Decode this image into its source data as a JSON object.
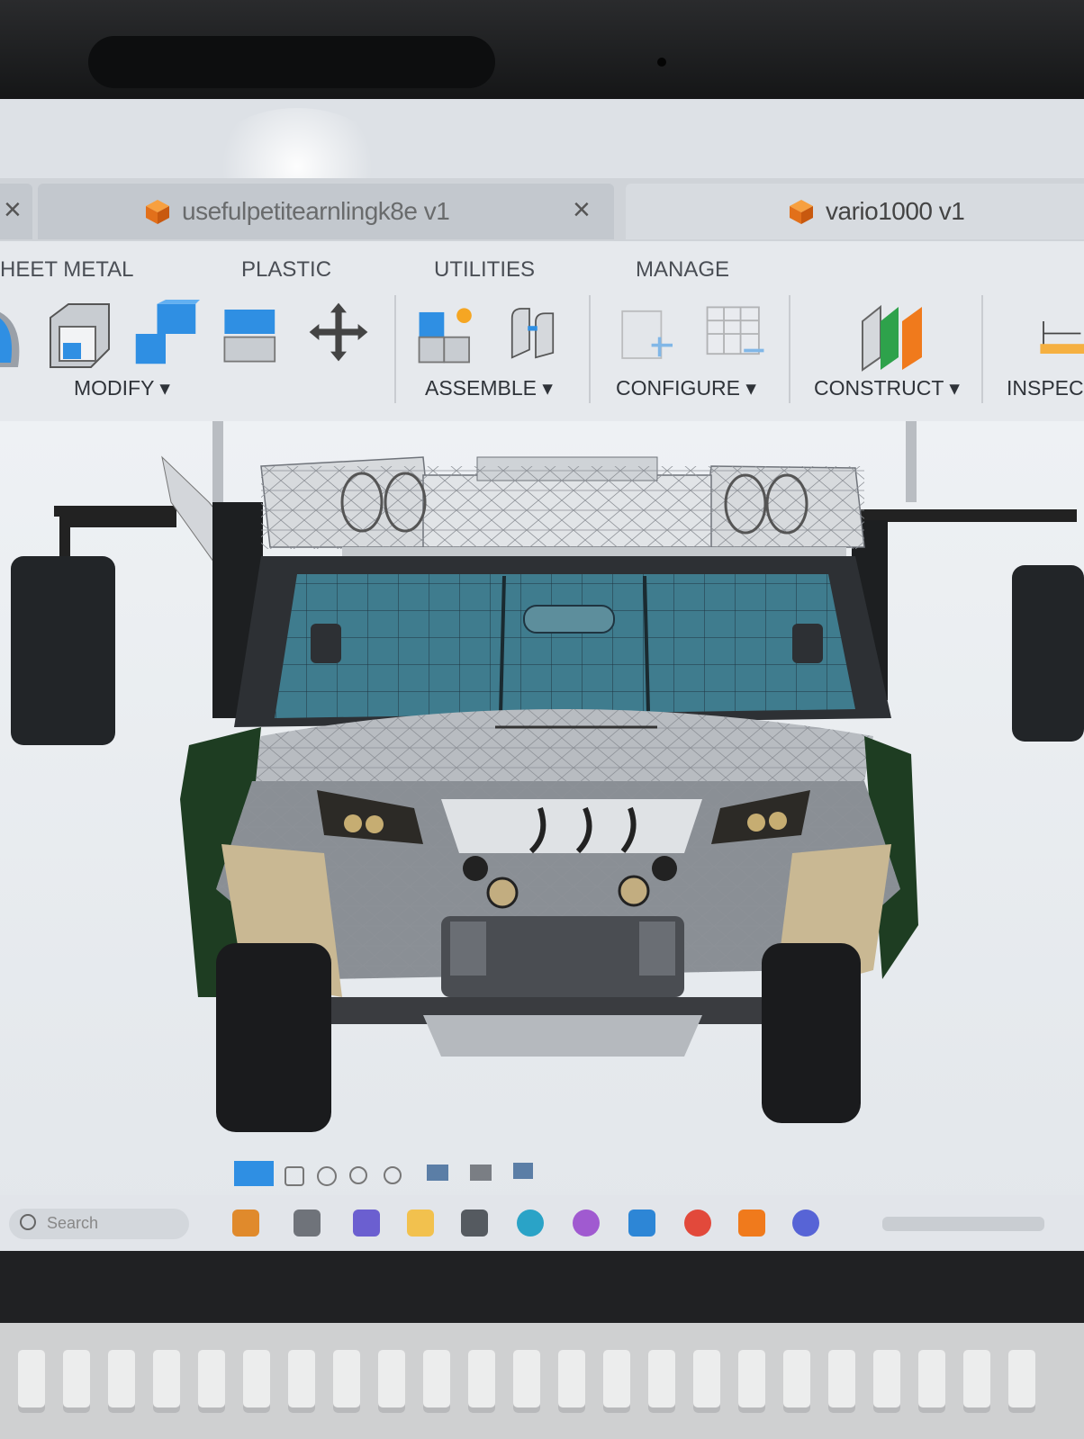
{
  "tabs": [
    {
      "label": "",
      "active": false
    },
    {
      "label": "usefulpetitearnlingk8e v1",
      "active": false
    },
    {
      "label": "vario1000 v1",
      "active": true
    }
  ],
  "toolbar": {
    "categories": [
      "HEET METAL",
      "PLASTIC",
      "UTILITIES",
      "MANAGE"
    ],
    "groups": [
      "MODIFY ▾",
      "ASSEMBLE ▾",
      "CONFIGURE ▾",
      "CONSTRUCT ▾",
      "INSPEC"
    ]
  },
  "taskbar": {
    "search_placeholder": "Search"
  },
  "colors": {
    "accent_blue": "#2f8fe3",
    "tab_icon_orange": "#f07a1c",
    "construct_green": "#2ea24b",
    "construct_orange": "#f07a1c"
  }
}
